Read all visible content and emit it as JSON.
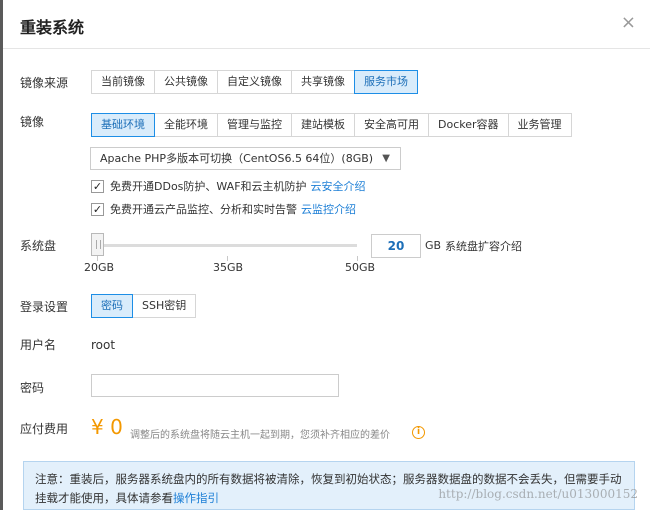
{
  "dialog": {
    "title": "重装系统",
    "close_icon": "×"
  },
  "image_source": {
    "label": "镜像来源",
    "options": [
      "当前镜像",
      "公共镜像",
      "自定义镜像",
      "共享镜像",
      "服务市场"
    ],
    "selected": "服务市场"
  },
  "image": {
    "label": "镜像",
    "categories": [
      "基础环境",
      "全能环境",
      "管理与监控",
      "建站模板",
      "安全高可用",
      "Docker容器",
      "业务管理"
    ],
    "selected": "基础环境",
    "select_value": "Apache PHP多版本可切换（CentOS6.5 64位）(8GB)",
    "options": [
      {
        "text": "免费开通DDos防护、WAF和云主机防护",
        "link": "云安全介绍",
        "checked": true
      },
      {
        "text": "免费开通云产品监控、分析和实时告警",
        "link": "云监控介绍",
        "checked": true
      }
    ]
  },
  "system_disk": {
    "label": "系统盘",
    "value": "20",
    "unit": "GB",
    "link": "系统盘扩容介绍",
    "ticks": [
      "20GB",
      "35GB",
      "50GB"
    ],
    "min": 20,
    "max": 50
  },
  "login": {
    "label": "登录设置",
    "options": [
      "密码",
      "SSH密钥"
    ],
    "selected": "密码"
  },
  "username": {
    "label": "用户名",
    "value": "root"
  },
  "password": {
    "label": "密码",
    "value": ""
  },
  "fee": {
    "label": "应付费用",
    "amount": "¥ 0",
    "note": "调整后的系统盘将随云主机一起到期，您须补齐相应的差价"
  },
  "notice": {
    "text": "注意：重装后，服务器系统盘内的所有数据将被清除，恢复到初始状态；服务器数据盘的数据不会丢失，但需要手动挂载才能使用，具体请参看",
    "link": "操作指引"
  },
  "watermark": "http://blog.csdn.net/u013000152",
  "colors": {
    "accent": "#1d7fd6",
    "selected_bg": "#d9ecfb",
    "price": "#f39800",
    "notice_bg": "#e3f0fb"
  }
}
